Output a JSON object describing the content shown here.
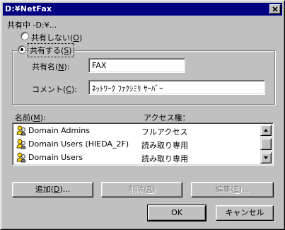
{
  "window": {
    "title": "D:¥NetFax"
  },
  "share": {
    "status_label": "共有中 -D:¥...",
    "not_shared_label": "共有しない(",
    "not_shared_key": "O",
    "shared_label": "共有する(",
    "shared_key": "S",
    "selected": "shared",
    "share_name_label": "共有名(",
    "share_name_key": "N",
    "share_name_value": "FAX",
    "comment_label": "コメント(",
    "comment_key": "C",
    "comment_value": "ﾈｯﾄﾜｰｸ ﾌｧｸｼﾐﾘ ｻｰﾊﾞｰ"
  },
  "permissions": {
    "name_header": "名前(",
    "name_header_key": "M",
    "name_header_suffix": "):",
    "access_header": "アクセス権：",
    "rows": [
      {
        "name": "Domain Admins",
        "access": "フルアクセス"
      },
      {
        "name": "Domain Users (HIEDA_2F)",
        "access": "読み取り専用"
      },
      {
        "name": "Domain Users",
        "access": "読み取り専用"
      }
    ]
  },
  "buttons": {
    "add": "追加(",
    "add_key": "D",
    "add_suffix": ")...",
    "remove": "削除(",
    "remove_key": "R",
    "remove_suffix": ")",
    "edit": "編集(",
    "edit_key": "E",
    "edit_suffix": ")...",
    "ok": "OK",
    "cancel": "キャンセル"
  },
  "icons": [
    "close-icon",
    "user-group-icon",
    "scroll-up-arrow-icon",
    "scroll-down-arrow-icon"
  ]
}
